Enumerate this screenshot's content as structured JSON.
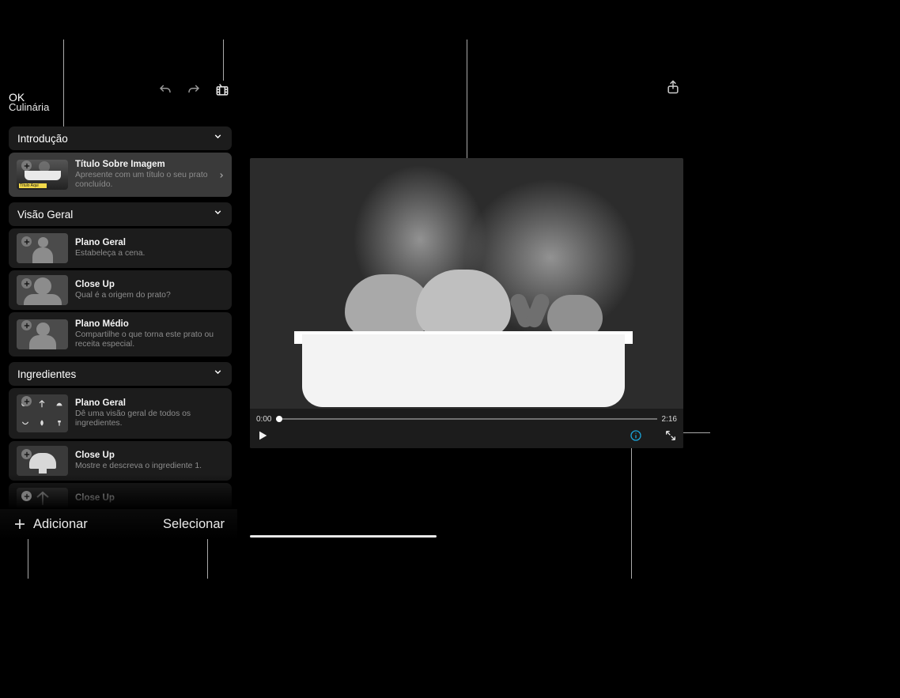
{
  "header": {
    "ok": "OK",
    "project_title": "Culinária"
  },
  "sections": [
    {
      "id": "intro",
      "label": "Introdução",
      "shots": [
        {
          "id": "title_over_image",
          "title": "Título Sobre Imagem",
          "desc": "Apresente com um título o seu prato concluído.",
          "thumb_tag": "Título Aqui",
          "selected": true,
          "has_chevron": true
        }
      ]
    },
    {
      "id": "overview",
      "label": "Visão Geral",
      "shots": [
        {
          "id": "wide",
          "title": "Plano Geral",
          "desc": "Estabeleça a cena."
        },
        {
          "id": "close1",
          "title": "Close Up",
          "desc": "Qual é a origem do prato?"
        },
        {
          "id": "medium",
          "title": "Plano Médio",
          "desc": "Compartilhe o que torna este prato ou receita especial."
        }
      ]
    },
    {
      "id": "ingredients",
      "label": "Ingredientes",
      "shots": [
        {
          "id": "ing_wide",
          "title": "Plano Geral",
          "desc": "Dê uma visão geral de todos os ingredientes."
        },
        {
          "id": "ing_close1",
          "title": "Close Up",
          "desc": "Mostre e descreva o ingrediente 1."
        },
        {
          "id": "ing_close2",
          "title": "Close Up",
          "desc": ""
        }
      ]
    }
  ],
  "sidebar_bottom": {
    "add": "Adicionar",
    "select": "Selecionar"
  },
  "viewer": {
    "time_start": "0:00",
    "time_end": "2:16"
  }
}
